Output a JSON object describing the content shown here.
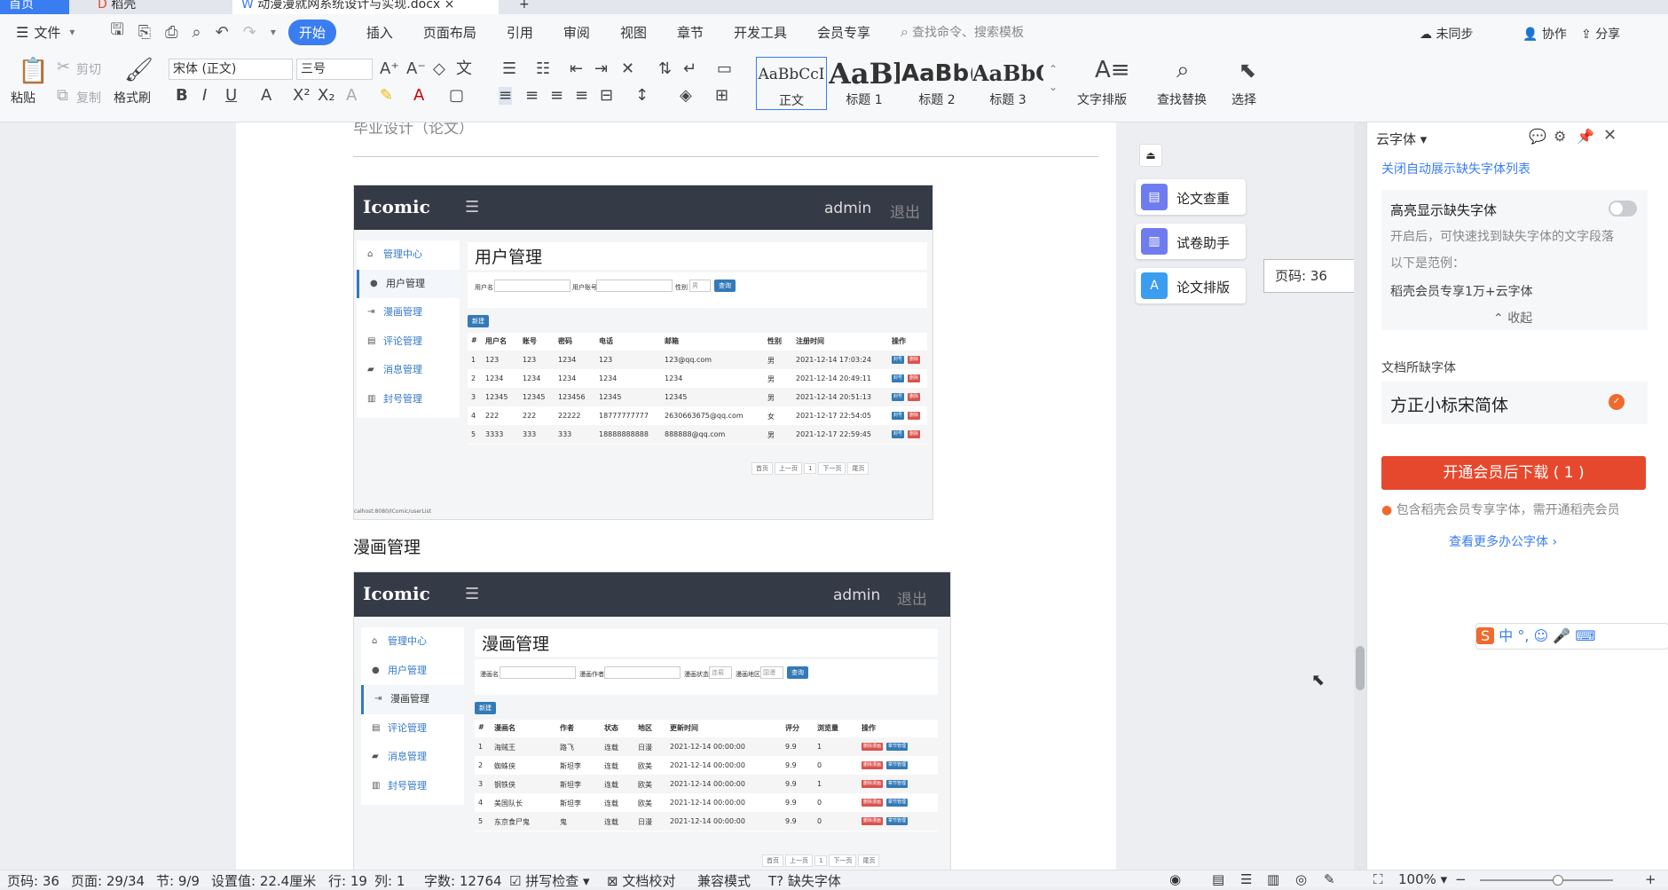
{
  "tabs": [
    "首页",
    "稻壳",
    "动漫漫就网系统设计与实现.docx"
  ],
  "menu": {
    "file": "文件",
    "items": [
      "开始",
      "插入",
      "页面布局",
      "引用",
      "审阅",
      "视图",
      "章节",
      "开发工具",
      "会员专享"
    ],
    "search_placeholder": "查找命令、搜索模板",
    "sync": "未同步",
    "collab": "协作",
    "share": "分享"
  },
  "ribbon": {
    "paste": "粘贴",
    "cut": "剪切",
    "copy": "复制",
    "format_painter": "格式刷",
    "font": "宋体 (正文)",
    "size": "三号",
    "styles": [
      {
        "preview": "AaBbCcI",
        "name": "正文"
      },
      {
        "preview": "AaBl",
        "name": "标题 1"
      },
      {
        "preview": "AaBb(",
        "name": "标题 2"
      },
      {
        "preview": "AaBbC",
        "name": "标题 3"
      }
    ],
    "text_layout": "文字排版",
    "find_replace": "查找替换",
    "select": "选择"
  },
  "doc": {
    "header_text": "毕业设计（论文）",
    "section_title": "漫画管理",
    "shot1": {
      "logo": "Icomic",
      "admin": "admin",
      "logout": "退出",
      "page_title": "用户管理",
      "menu": [
        "管理中心",
        "用户管理",
        "漫画管理",
        "评论管理",
        "消息管理",
        "封号管理"
      ],
      "search": {
        "labels": [
          "用户名",
          "用户账号",
          "性别"
        ],
        "gender": "男",
        "query": "查询"
      },
      "new_btn": "新建",
      "columns": [
        "#",
        "用户名",
        "账号",
        "密码",
        "电话",
        "邮箱",
        "性别",
        "注册时间",
        "操作"
      ],
      "rows": [
        [
          "1",
          "123",
          "123",
          "1234",
          "123",
          "123@qq.com",
          "男",
          "2021-12-14 17:03:24"
        ],
        [
          "2",
          "1234",
          "1234",
          "1234",
          "1234",
          "1234",
          "男",
          "2021-12-14 20:49:11"
        ],
        [
          "3",
          "12345",
          "12345",
          "123456",
          "12345",
          "12345",
          "男",
          "2021-12-14 20:51:13"
        ],
        [
          "4",
          "222",
          "222",
          "22222",
          "18777777777",
          "2630663675@qq.com",
          "女",
          "2021-12-17 22:54:05"
        ],
        [
          "5",
          "3333",
          "333",
          "333",
          "18888888888",
          "888888@qq.com",
          "男",
          "2021-12-17 22:59:45"
        ]
      ],
      "actions": [
        "封号",
        "删除"
      ],
      "pager": [
        "首页",
        "上一页",
        "1",
        "下一页",
        "尾页"
      ],
      "url": "calhost:8080/IComic/userList"
    },
    "shot2": {
      "logo": "Icomic",
      "admin": "admin",
      "logout": "退出",
      "page_title": "漫画管理",
      "menu": [
        "管理中心",
        "用户管理",
        "漫画管理",
        "评论管理",
        "消息管理",
        "封号管理"
      ],
      "search": {
        "labels": [
          "漫画名",
          "漫画作者",
          "漫画状态",
          "漫画地区"
        ],
        "status": "连载",
        "region": "国漫",
        "query": "查询"
      },
      "new_btn": "新建",
      "columns": [
        "#",
        "漫画名",
        "作者",
        "状态",
        "地区",
        "更新时间",
        "评分",
        "浏览量",
        "操作"
      ],
      "rows": [
        [
          "1",
          "海贼王",
          "路飞",
          "连载",
          "日漫",
          "2021-12-14 00:00:00",
          "9.9",
          "1"
        ],
        [
          "2",
          "蜘蛛侠",
          "斯坦李",
          "连载",
          "欧美",
          "2021-12-14 00:00:00",
          "9.9",
          "0"
        ],
        [
          "3",
          "钢铁侠",
          "斯坦李",
          "连载",
          "欧美",
          "2021-12-14 00:00:00",
          "9.9",
          "1"
        ],
        [
          "4",
          "美国队长",
          "斯坦李",
          "连载",
          "欧美",
          "2021-12-14 00:00:00",
          "9.9",
          "0"
        ],
        [
          "5",
          "东京食尸鬼",
          "鬼",
          "连载",
          "日漫",
          "2021-12-14 00:00:00",
          "9.9",
          "0"
        ]
      ],
      "actions": [
        "删除漫画",
        "章节管理"
      ],
      "pager": [
        "首页",
        "上一页",
        "1",
        "下一页",
        "尾页"
      ]
    }
  },
  "tools": [
    "论文查重",
    "试卷助手",
    "论文排版"
  ],
  "page_badge": "页码: 36",
  "right": {
    "title": "云字体",
    "close_auto": "关闭自动展示缺失字体列表",
    "highlight": "高亮显示缺失字体",
    "desc1": "开启后，可快速找到缺失字体的文字段落",
    "desc2": "以下是范例：",
    "desc3": "稻壳会员专享1万+云字体",
    "collapse": "收起",
    "missing_title": "文档所缺字体",
    "missing_font": "方正小标宋简体",
    "download": "开通会员后下载 ( 1 )",
    "member_note": "包含稻壳会员专享字体，需开通稻壳会员",
    "more": "查看更多办公字体",
    "ime": [
      "中",
      "°,"
    ]
  },
  "status": {
    "page": "页码: 36",
    "pages": "页面: 29/34",
    "section": "节: 9/9",
    "setting": "设置值: 22.4厘米",
    "row": "行: 19",
    "col": "列: 1",
    "words": "字数: 12764",
    "spell": "拼写检查",
    "proof": "文档校对",
    "compat": "兼容模式",
    "missing": "缺失字体",
    "zoom": "100%"
  },
  "colors": {
    "accent": "#3a7df0",
    "download": "#e5482d",
    "tool_icon": "#6f7cf0"
  }
}
